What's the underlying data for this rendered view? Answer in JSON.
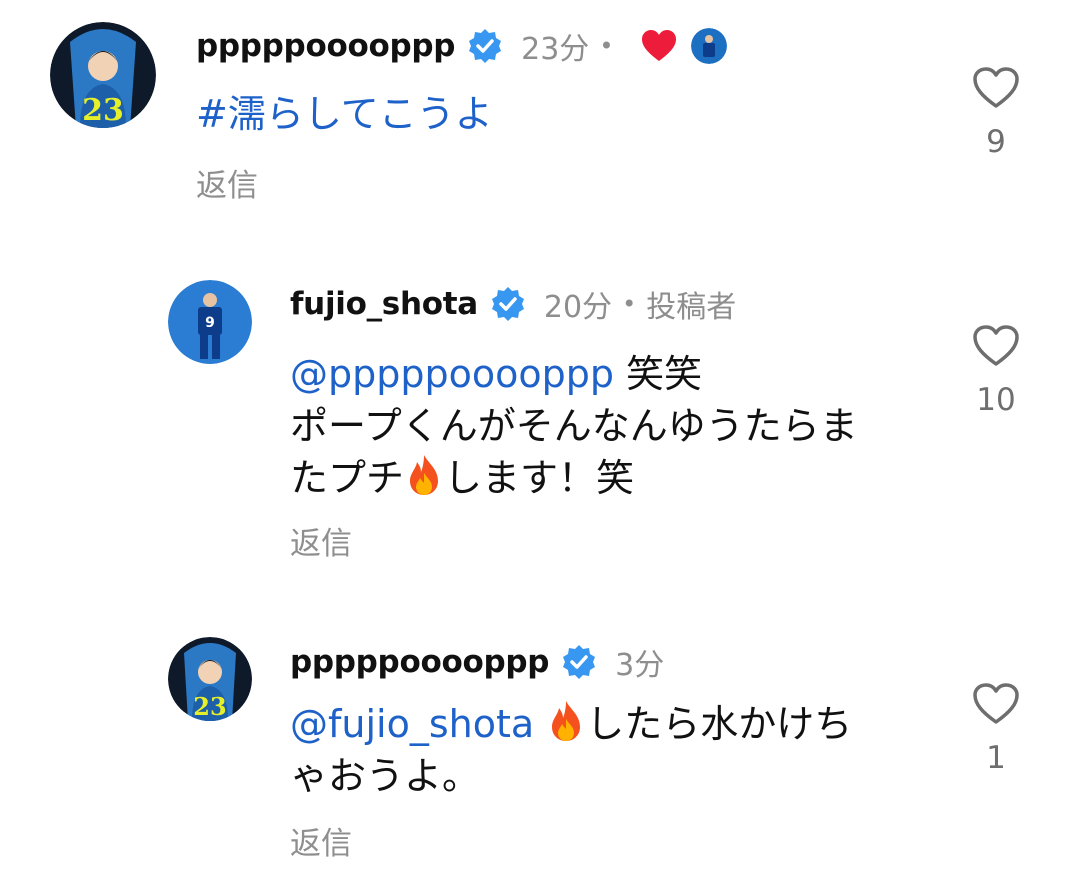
{
  "comments": [
    {
      "username": "pppppooooppp",
      "time": "23分",
      "dot": "•",
      "text": "#濡らしてこうよ",
      "reply_label": "返信",
      "like_count": "9",
      "avatar_number": "23"
    },
    {
      "username": "fujio_shota",
      "time": "20分",
      "dot": "•",
      "author_label": "投稿者",
      "mention": "@pppppooooppp",
      "text_line1": " 笑笑",
      "text_line2": "ポープくんがそんなんゆうたらま",
      "text_line3a": "たプチ",
      "text_line3b": "します！笑",
      "reply_label": "返信",
      "like_count": "10",
      "avatar_number": "9"
    },
    {
      "username": "pppppooooppp",
      "time": "3分",
      "mention": "@fujio_shota",
      "text_line1": "したら水かけち",
      "text_line2": "ゃおうよ。",
      "reply_label": "返信",
      "like_count": "1",
      "avatar_number": "23"
    }
  ],
  "colors": {
    "link": "#1e62c9",
    "verified": "#3897f0",
    "muted": "#8e8e8e",
    "liked_heart": "#ed1c3a"
  },
  "icons": [
    "verified-badge-icon",
    "heart-outline-icon",
    "heart-filled-icon",
    "fire-emoji-icon"
  ]
}
